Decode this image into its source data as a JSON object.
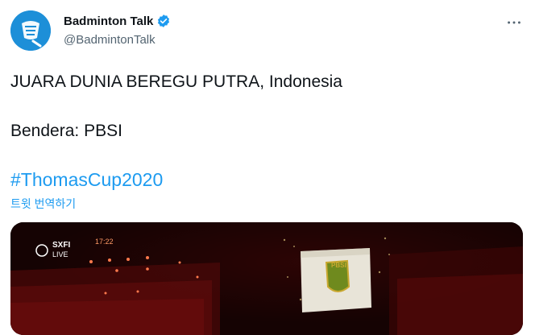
{
  "tweet": {
    "display_name": "Badminton Talk",
    "handle": "@BadmintonTalk",
    "lines": [
      "JUARA DUNIA BEREGU PUTRA, Indonesia",
      "Bendera: PBSI"
    ],
    "hashtag": "#ThomasCup2020",
    "translate_label": "트윗 번역하기"
  },
  "media": {
    "overlay_brand": "SXFI",
    "overlay_live": "LIVE",
    "overlay_time": "17:22",
    "flag_text": "PBSI"
  },
  "icons": {
    "avatar": "shuttlecock-logo-icon",
    "verified": "verified-badge-icon",
    "more": "more-options-icon"
  },
  "colors": {
    "accent": "#1d9bf0",
    "avatar_bg": "#1d8fd8",
    "secondary_text": "#536471"
  }
}
